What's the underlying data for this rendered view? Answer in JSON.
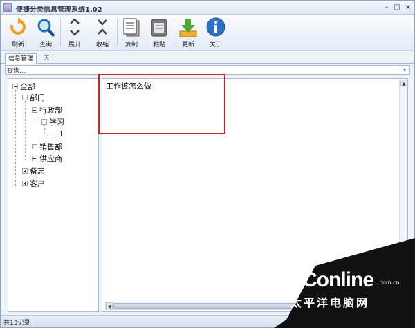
{
  "window": {
    "title": "便捷分类信息管理系统1.02",
    "controls": {
      "minimize": "–",
      "maximize": "□",
      "close": "×"
    }
  },
  "toolbar": {
    "items": [
      {
        "label": "刷新",
        "icon": "refresh-icon"
      },
      {
        "label": "查询",
        "icon": "search-icon"
      },
      {
        "label": "展开",
        "icon": "expand-icon"
      },
      {
        "label": "收缩",
        "icon": "collapse-icon"
      },
      {
        "label": "复制",
        "icon": "copy-icon"
      },
      {
        "label": "粘贴",
        "icon": "paste-icon"
      },
      {
        "label": "更新",
        "icon": "download-icon"
      },
      {
        "label": "关于",
        "icon": "info-icon"
      }
    ]
  },
  "tabs": [
    {
      "label": "信息管理",
      "active": true
    },
    {
      "label": "关于",
      "active": false
    }
  ],
  "search": {
    "value": "查询..."
  },
  "tree": {
    "root": "全部",
    "dept": "部门",
    "admin": "行政部",
    "study": "学习",
    "leaf": "1",
    "sales": "销售部",
    "supplier": "供应商",
    "memo": "备忘",
    "customer": "客户"
  },
  "editor": {
    "text": "工作该怎么做"
  },
  "status": {
    "text": "共13记录"
  },
  "watermark": {
    "logo": "PConline",
    "domain": ".com.cn",
    "sub": "太平洋电脑网"
  },
  "colors": {
    "highlight": "#c8222a",
    "accent": "#2f6fc4"
  }
}
